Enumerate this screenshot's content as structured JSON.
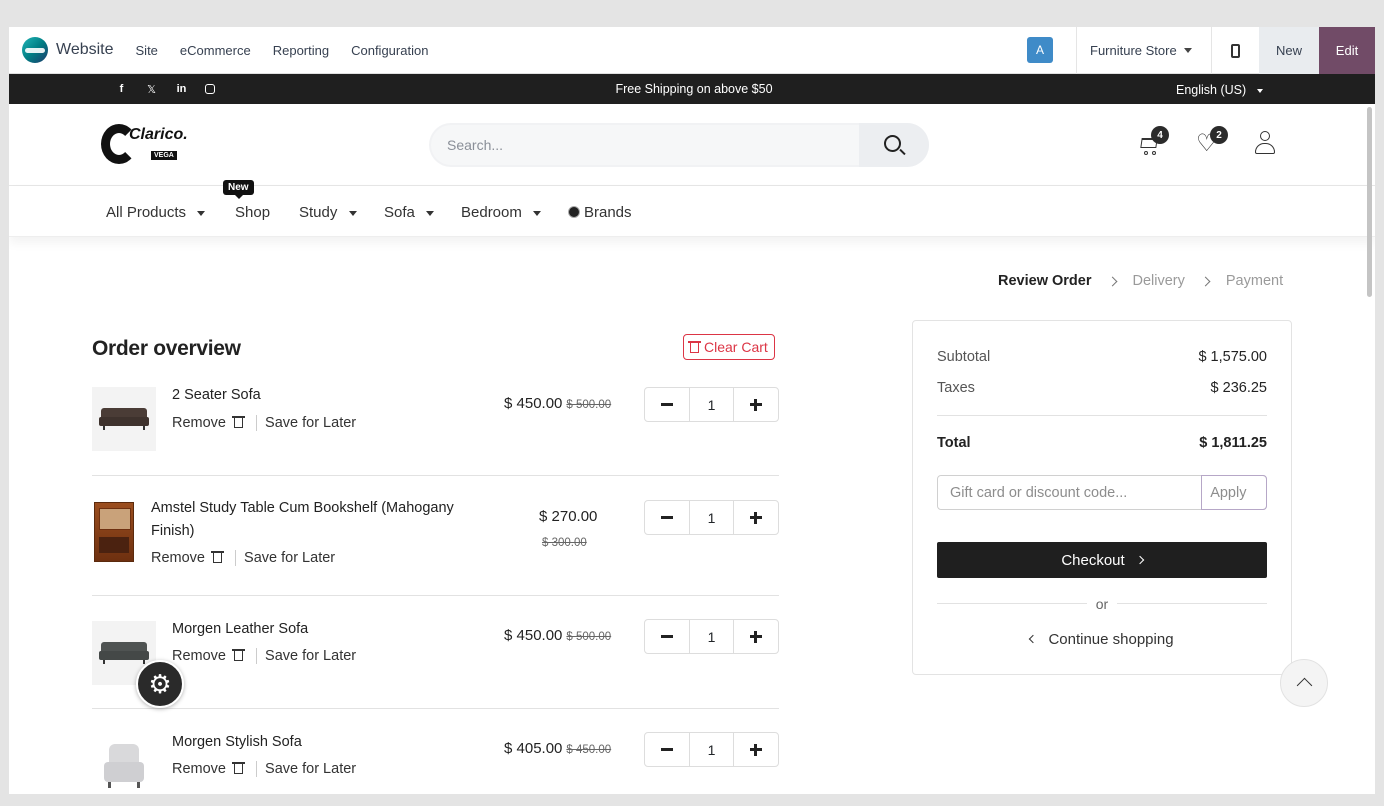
{
  "editor": {
    "app_name": "Website",
    "menu": [
      "Site",
      "eCommerce",
      "Reporting",
      "Configuration"
    ],
    "avatar_letter": "A",
    "store": "Furniture Store",
    "new_label": "New",
    "edit_label": "Edit"
  },
  "announcement": {
    "text": "Free Shipping on above $50",
    "language": "English (US)",
    "socials": [
      "facebook-icon",
      "x-icon",
      "linkedin-icon",
      "instagram-icon"
    ]
  },
  "header": {
    "logo_text": "Clarico.",
    "logo_sub": "VEGA",
    "search_placeholder": "Search...",
    "cart_count": "4",
    "wishlist_count": "2"
  },
  "nav": {
    "new_tag": "New",
    "items": [
      "All Products",
      "Shop",
      "Study",
      "Sofa",
      "Bedroom",
      "Brands"
    ]
  },
  "steps": [
    "Review Order",
    "Delivery",
    "Payment"
  ],
  "order": {
    "title": "Order overview",
    "clear_cart": "Clear Cart",
    "remove_label": "Remove",
    "save_label": "Save for Later",
    "items": [
      {
        "name": "2 Seater Sofa",
        "price": "$ 450.00",
        "old_price": "$ 500.00",
        "qty": "1"
      },
      {
        "name": "Amstel Study Table Cum Bookshelf (Mahogany Finish)",
        "price": "$ 270.00",
        "old_price": "$ 300.00",
        "qty": "1"
      },
      {
        "name": "Morgen Leather Sofa",
        "price": "$ 450.00",
        "old_price": "$ 500.00",
        "qty": "1"
      },
      {
        "name": "Morgen Stylish Sofa",
        "price": "$ 405.00",
        "old_price": "$ 450.00",
        "qty": "1"
      }
    ]
  },
  "summary": {
    "subtotal_label": "Subtotal",
    "subtotal": "$ 1,575.00",
    "taxes_label": "Taxes",
    "taxes": "$ 236.25",
    "total_label": "Total",
    "total": "$ 1,811.25",
    "gift_placeholder": "Gift card or discount code...",
    "apply_label": "Apply",
    "checkout_label": "Checkout",
    "or_label": "or",
    "continue_label": "Continue shopping"
  },
  "colors": {
    "edit_button": "#714b67",
    "announcement_bg": "#1f1f1f",
    "clear_cart": "#dc3545",
    "avatar": "#3f8bc8"
  }
}
